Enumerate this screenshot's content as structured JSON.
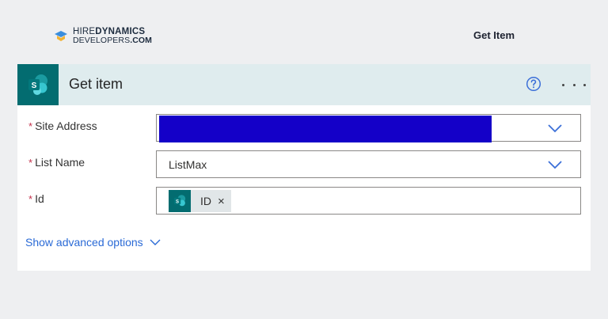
{
  "brand": {
    "line1_regular": "HIRE",
    "line1_bold": "DYNAMICS",
    "line2_regular": "DEVELOPERS",
    "line2_bold": ".COM"
  },
  "page_title": "Get Item",
  "action_card": {
    "title": "Get item",
    "icon": "sharepoint-icon",
    "fields": {
      "site_address": {
        "required_mark": "*",
        "label": "Site Address",
        "value_redacted": true
      },
      "list_name": {
        "required_mark": "*",
        "label": "List Name",
        "value": "ListMax"
      },
      "id": {
        "required_mark": "*",
        "label": "Id",
        "token_label": "ID",
        "token_remove": "×"
      }
    },
    "advanced_link": "Show advanced options"
  },
  "colors": {
    "header_bg": "#dfecee",
    "sharepoint_teal": "#036c70",
    "link_blue": "#2a6ad6",
    "redaction_blue": "#1400c8",
    "required_red": "#c4314b"
  }
}
